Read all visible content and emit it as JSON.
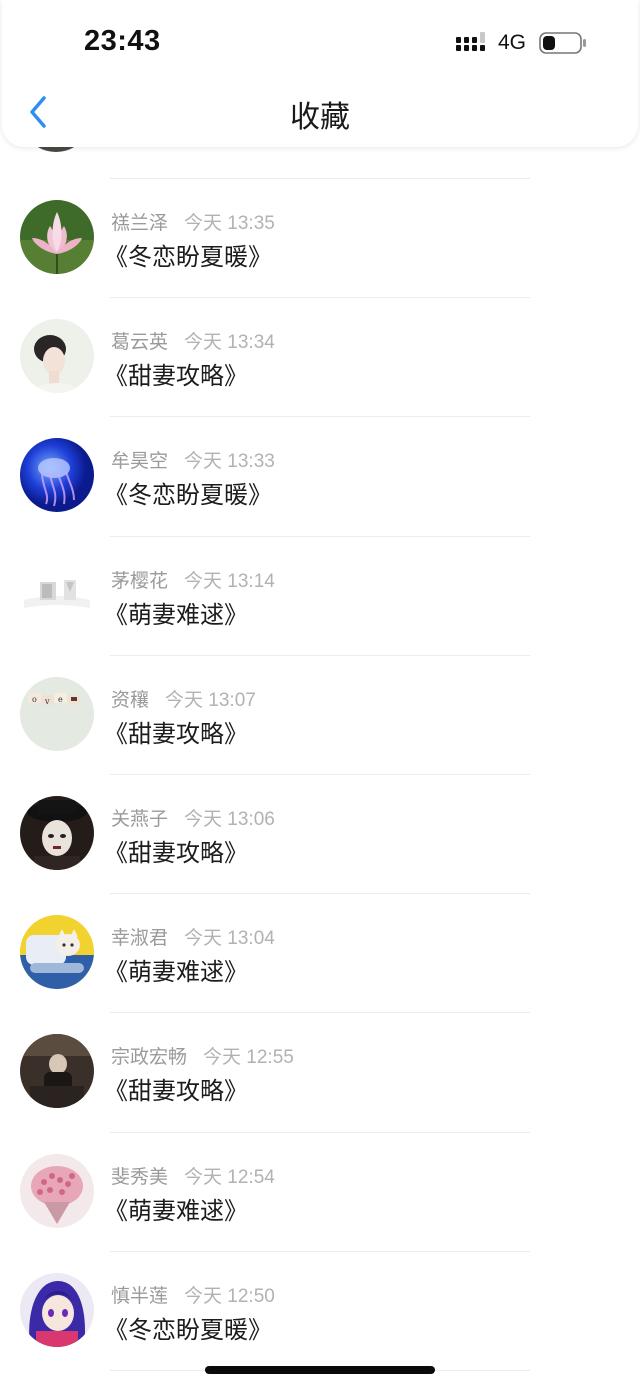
{
  "status_bar": {
    "time": "23:43",
    "network": "4G",
    "battery_level": 0.35
  },
  "header": {
    "title": "收藏",
    "back_icon": "chevron-left-icon",
    "accent_color": "#2f8ff0"
  },
  "favorites": [
    {
      "name": "禚兰泽",
      "time": "今天 13:35",
      "book": "《冬恋盼夏暖》",
      "avatar": "lotus-flower"
    },
    {
      "name": "葛云英",
      "time": "今天 13:34",
      "book": "《甜妻攻略》",
      "avatar": "woman-portrait"
    },
    {
      "name": "牟昊空",
      "time": "今天 13:33",
      "book": "《冬恋盼夏暖》",
      "avatar": "jellyfish"
    },
    {
      "name": "茅樱花",
      "time": "今天 13:14",
      "book": "《萌妻难逑》",
      "avatar": "white-cubes"
    },
    {
      "name": "资穰",
      "time": "今天 13:07",
      "book": "《甜妻攻略》",
      "avatar": "love-letters"
    },
    {
      "name": "关燕子",
      "time": "今天 13:06",
      "book": "《甜妻攻略》",
      "avatar": "hat-portrait"
    },
    {
      "name": "幸淑君",
      "time": "今天 13:04",
      "book": "《萌妻难逑》",
      "avatar": "cat-yellow"
    },
    {
      "name": "宗政宏畅",
      "time": "今天 12:55",
      "book": "《甜妻攻略》",
      "avatar": "dark-room"
    },
    {
      "name": "斐秀美",
      "time": "今天 12:54",
      "book": "《萌妻难逑》",
      "avatar": "pink-bouquet"
    },
    {
      "name": "慎半莲",
      "time": "今天 12:50",
      "book": "《冬恋盼夏暖》",
      "avatar": "anime-girl"
    }
  ]
}
